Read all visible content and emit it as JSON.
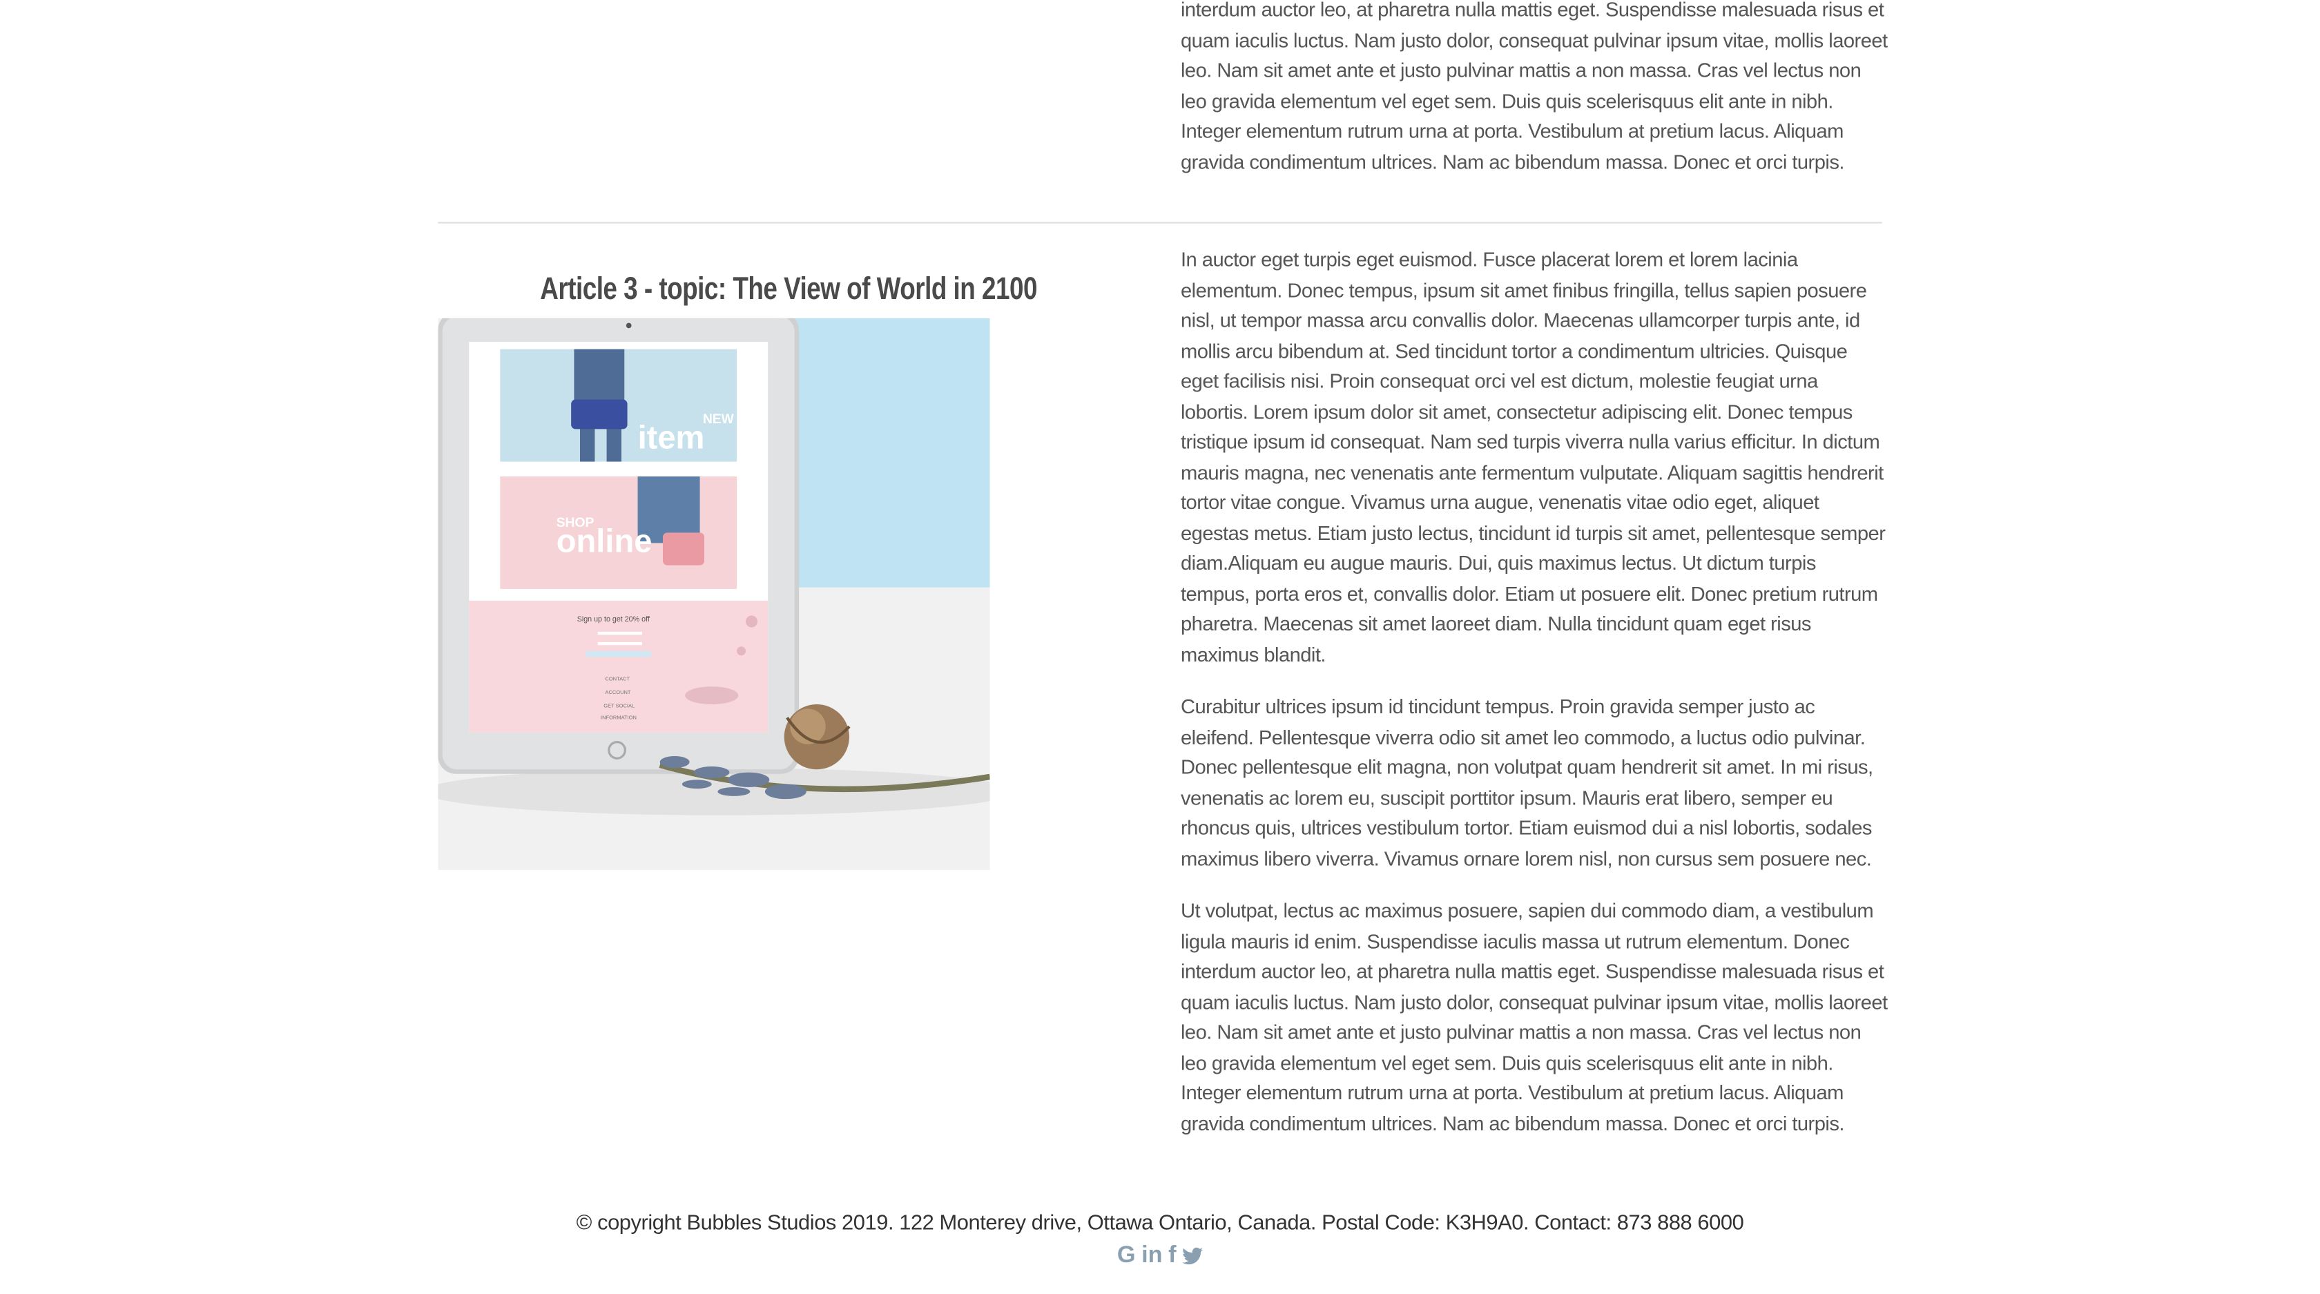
{
  "top_article": {
    "paragraph": "interdum auctor leo, at pharetra nulla mattis eget. Suspendisse malesuada risus et quam iaculis luctus. Nam justo dolor, consequat pulvinar ipsum vitae, mollis laoreet leo. Nam sit amet ante et justo pulvinar mattis a non massa. Cras vel lectus non leo gravida elementum vel eget sem. Duis quis scelerisquus elit ante in nibh. Integer elementum rutrum urna at porta. Vestibulum at pretium lacus. Aliquam gravida condimentum ultrices. Nam ac bibendum massa. Donec et orci turpis."
  },
  "article3": {
    "title": "Article 3 - topic: The View of World in 2100",
    "image": {
      "item_badge_small": "NEW",
      "item_badge": "item",
      "shop_small": "SHOP",
      "shop_label": "online",
      "signup_text": "Sign up to get 20% off",
      "menu_items": [
        "CONTACT",
        "ACCOUNT",
        "GET SOCIAL",
        "INFORMATION"
      ]
    },
    "paragraphs": [
      "In auctor eget turpis eget euismod. Fusce placerat lorem et lorem lacinia elementum. Donec tempus, ipsum sit amet finibus fringilla, tellus sapien posuere nisl, ut tempor massa arcu convallis dolor. Maecenas ullamcorper turpis ante, id mollis arcu bibendum at. Sed tincidunt tortor a condimentum ultricies. Quisque eget facilisis nisi. Proin consequat orci vel est dictum, molestie feugiat urna lobortis. Lorem ipsum dolor sit amet, consectetur adipiscing elit. Donec tempus tristique ipsum id consequat. Nam sed turpis viverra nulla varius efficitur. In dictum mauris magna, nec venenatis ante fermentum vulputate. Aliquam sagittis hendrerit tortor vitae congue. Vivamus urna augue, venenatis vitae odio eget, aliquet egestas metus. Etiam justo lectus, tincidunt id turpis sit amet, pellentesque semper diam.Aliquam eu augue mauris. Dui, quis maximus lectus. Ut dictum turpis tempus, porta eros et, convallis dolor. Etiam ut posuere elit. Donec pretium rutrum pharetra. Maecenas sit amet laoreet diam. Nulla tincidunt quam eget risus maximus blandit.",
      "Curabitur ultrices ipsum id tincidunt tempus. Proin gravida semper justo ac eleifend. Pellentesque viverra odio sit amet leo commodo, a luctus odio pulvinar. Donec pellentesque elit magna, non volutpat quam hendrerit sit amet. In mi risus, venenatis ac lorem eu, suscipit porttitor ipsum. Mauris erat libero, semper eu rhoncus quis, ultrices vestibulum tortor. Etiam euismod dui a nisl lobortis, sodales maximus libero viverra. Vivamus ornare lorem nisl, non cursus sem posuere nec.",
      "Ut volutpat, lectus ac maximus posuere, sapien dui commodo diam, a vestibulum ligula mauris id enim. Suspendisse iaculis massa ut rutrum elementum. Donec interdum auctor leo, at pharetra nulla mattis eget. Suspendisse malesuada risus et quam iaculis luctus. Nam justo dolor, consequat pulvinar ipsum vitae, mollis laoreet leo. Nam sit amet ante et justo pulvinar mattis a non massa. Cras vel lectus non leo gravida elementum vel eget sem. Duis quis scelerisquus elit ante in nibh. Integer elementum rutrum urna at porta. Vestibulum at pretium lacus. Aliquam gravida condimentum ultrices. Nam ac bibendum massa. Donec et orci turpis."
    ]
  },
  "footer": {
    "text": "© copyright Bubbles Studios 2019. 122 Monterey drive, Ottawa Ontario, Canada. Postal Code: K3H9A0. Contact: 873 888 6000",
    "socials": [
      {
        "icon": "google-icon",
        "glyph": "G"
      },
      {
        "icon": "linkedin-icon",
        "glyph": "in"
      },
      {
        "icon": "facebook-icon",
        "glyph": "f"
      },
      {
        "icon": "twitter-icon",
        "glyph": ""
      }
    ],
    "icon_color": "#8a9fb0"
  }
}
